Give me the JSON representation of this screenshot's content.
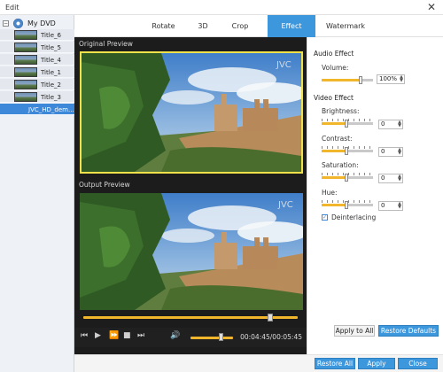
{
  "window": {
    "title": "Edit"
  },
  "sidebar": {
    "root_label": "My DVD",
    "items": [
      {
        "label": "Title_6"
      },
      {
        "label": "Title_5"
      },
      {
        "label": "Title_4"
      },
      {
        "label": "Title_1"
      },
      {
        "label": "Title_2"
      },
      {
        "label": "Title_3"
      },
      {
        "label": "JVC_HD_dem..."
      }
    ]
  },
  "tabs": [
    {
      "label": "Rotate"
    },
    {
      "label": "3D"
    },
    {
      "label": "Crop"
    },
    {
      "label": "Effect"
    },
    {
      "label": "Watermark"
    }
  ],
  "active_tab": "Effect",
  "preview": {
    "original_label": "Original Preview",
    "output_label": "Output Preview",
    "watermark_text": "JVC",
    "time": "00:04:45/00:05:45",
    "progress_fraction": 0.87,
    "volume_fraction": 0.7
  },
  "effect": {
    "audio_title": "Audio Effect",
    "volume_label": "Volume:",
    "volume_value": "100%",
    "video_title": "Video Effect",
    "brightness_label": "Brightness:",
    "brightness_value": "0",
    "contrast_label": "Contrast:",
    "contrast_value": "0",
    "saturation_label": "Saturation:",
    "saturation_value": "0",
    "hue_label": "Hue:",
    "hue_value": "0",
    "deinterlacing_label": "Deinterlacing",
    "deinterlacing_checked": true
  },
  "buttons": {
    "apply_to_all": "Apply to All",
    "restore_defaults": "Restore Defaults",
    "restore_all": "Restore All",
    "apply": "Apply",
    "close": "Close"
  },
  "colors": {
    "accent": "#3d97dc",
    "slider": "#f2b62c",
    "frame_highlight": "#f0e14a"
  }
}
